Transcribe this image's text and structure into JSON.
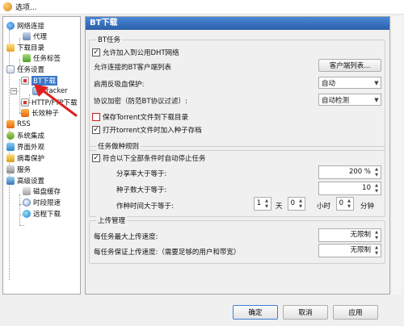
{
  "window": {
    "title": "选项..."
  },
  "tree": {
    "items": [
      {
        "label": "网络连接"
      },
      {
        "label": "代理"
      },
      {
        "label": "下载目录"
      },
      {
        "label": "任务标签"
      },
      {
        "label": "任务设置"
      },
      {
        "label": "BT下载"
      },
      {
        "label": "Tracker"
      },
      {
        "label": "HTTP/FTP下载"
      },
      {
        "label": "长效种子"
      },
      {
        "label": "RSS"
      },
      {
        "label": "系统集成"
      },
      {
        "label": "界面外观"
      },
      {
        "label": "病毒保护"
      },
      {
        "label": "服务"
      },
      {
        "label": "高级设置"
      },
      {
        "label": "磁盘缓存"
      },
      {
        "label": "时段限速"
      },
      {
        "label": "远程下载"
      }
    ]
  },
  "panel": {
    "title": "BT下载",
    "bt_task": {
      "group_title": "BT任务",
      "dht_label": "允许加入到公用DHT网络",
      "dht_checked": "✓",
      "client_list_label": "允许连接的BT客户端列表",
      "client_list_button": "客户端列表...",
      "anti_leech_label": "启用反吸血保护:",
      "anti_leech_value": "自动",
      "encryption_label": "协议加密（防范BT协议过滤）:",
      "encryption_value": "自动检测",
      "save_torrent_label": "保存Torrent文件到下载目录",
      "save_torrent_checked": "",
      "add_to_lib_label": "打开torrent文件时加入种子存档",
      "add_to_lib_checked": "✓"
    },
    "seeding": {
      "group_title": "任务做种规则",
      "auto_stop_label": "符合以下全部条件时自动停止任务",
      "auto_stop_checked": "✓",
      "ratio_label": "分享率大于等于:",
      "ratio_value": "200 %",
      "seeds_label": "种子数大于等于:",
      "seeds_value": "10",
      "time_label": "作种时间大于等于:",
      "days_value": "1",
      "days_unit": "天",
      "hours_value": "0",
      "hours_unit": "小时",
      "minutes_value": "0",
      "minutes_unit": "分钟"
    },
    "upload": {
      "group_title": "上传管理",
      "max_upload_label": "每任务最大上传速度:",
      "max_upload_value": "无限制",
      "guaranteed_label": "每任务保证上传速度:（需要足够的用户和带宽）",
      "guaranteed_value": "无限制"
    }
  },
  "footer": {
    "ok_label": "确定",
    "cancel_label": "取消",
    "apply_label": "应用"
  },
  "colors": {
    "header_gradient_top": "#4a87d6",
    "header_gradient_bottom": "#2c5fa8",
    "selected": "#3a78c8",
    "annotation_arrow": "#e02020"
  }
}
